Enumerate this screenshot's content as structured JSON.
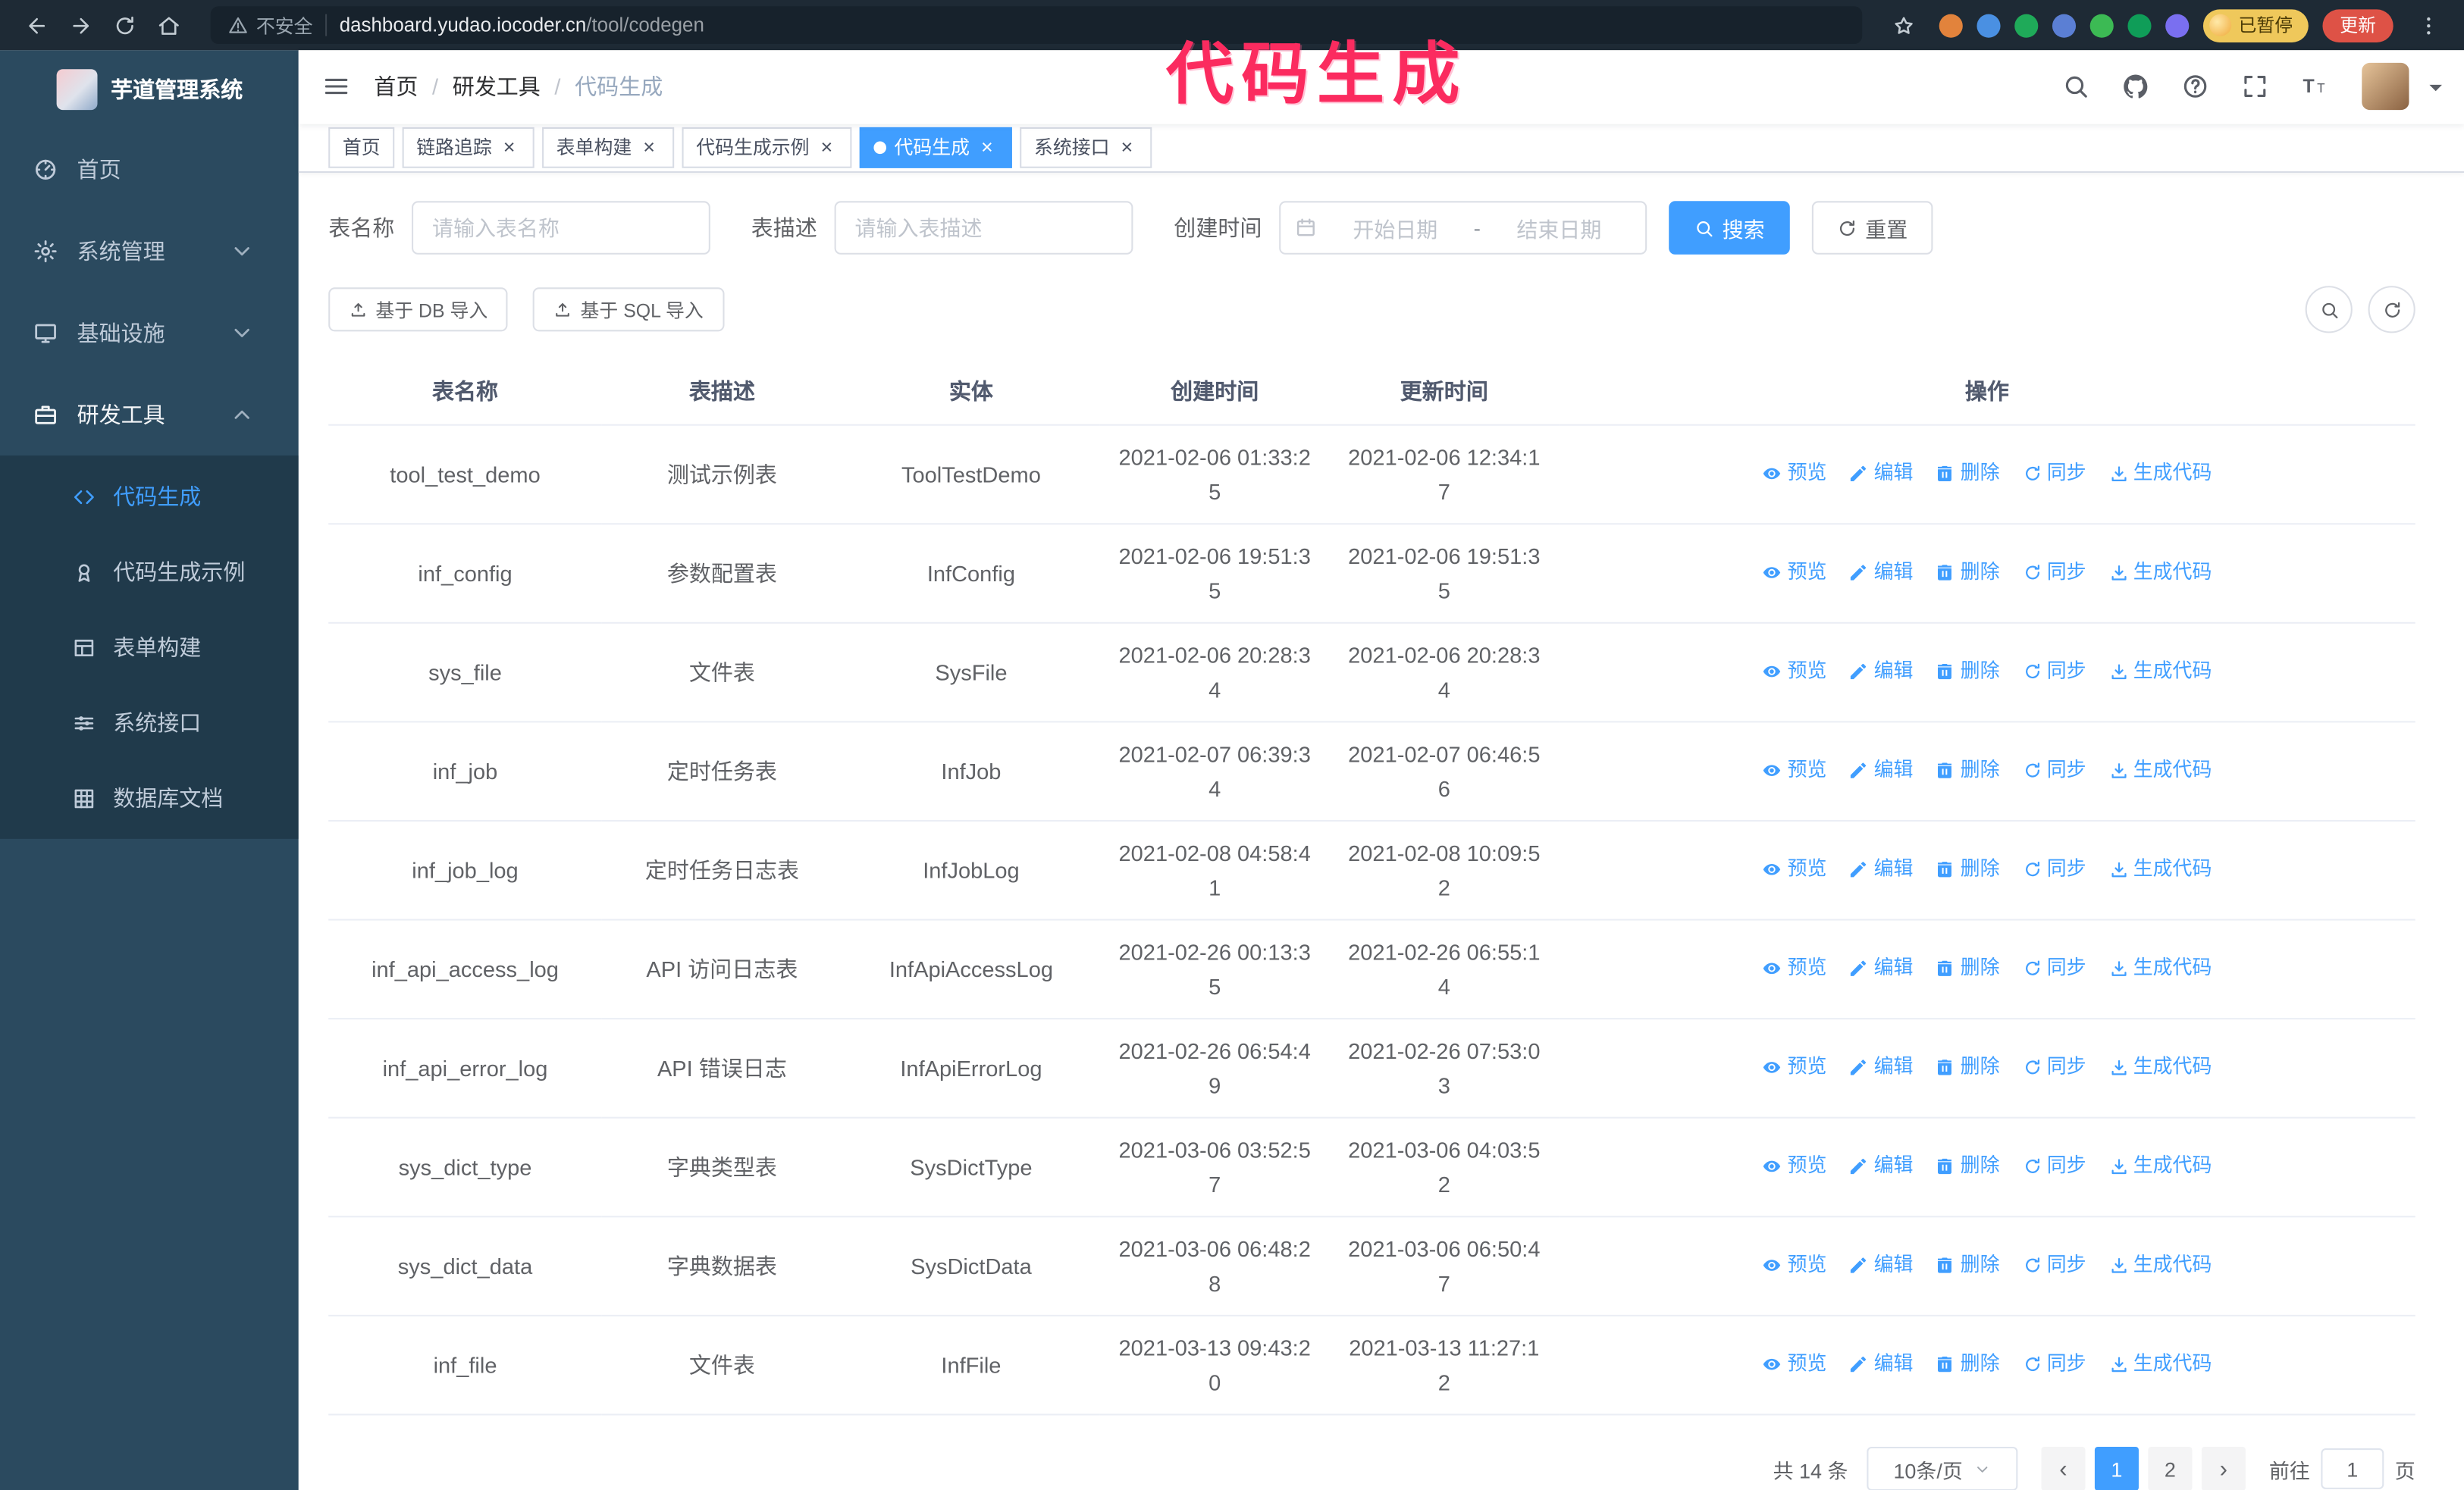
{
  "theme": {
    "accent": "#409eff"
  },
  "browser": {
    "security_label": "不安全",
    "url_host": "dashboard.yudao.iocoder.cn",
    "url_path": "/tool/codegen",
    "profile_chip": "已暂停",
    "update_button": "更新",
    "extension_colors": [
      "#e2833c",
      "#4a90e2",
      "#1faa59",
      "#5b7fd4",
      "#3cba54",
      "#0f9d58",
      "#7a6ff0"
    ]
  },
  "annotation": {
    "text": "代码生成",
    "color": "#fb2b5f"
  },
  "sidebar": {
    "logo_title": "芋道管理系统",
    "items": [
      {
        "key": "home",
        "label": "首页",
        "icon": "dashboard",
        "expandable": false,
        "expanded": false
      },
      {
        "key": "system",
        "label": "系统管理",
        "icon": "gear",
        "expandable": true,
        "expanded": false
      },
      {
        "key": "infra",
        "label": "基础设施",
        "icon": "monitor",
        "expandable": true,
        "expanded": false
      },
      {
        "key": "devtools",
        "label": "研发工具",
        "icon": "toolbox",
        "expandable": true,
        "expanded": true
      }
    ],
    "subitems": [
      {
        "key": "codegen",
        "label": "代码生成",
        "icon": "code",
        "active": true
      },
      {
        "key": "codegen-demo",
        "label": "代码生成示例",
        "icon": "badge",
        "active": false
      },
      {
        "key": "form-builder",
        "label": "表单构建",
        "icon": "form",
        "active": false
      },
      {
        "key": "api",
        "label": "系统接口",
        "icon": "sliders",
        "active": false
      },
      {
        "key": "db-doc",
        "label": "数据库文档",
        "icon": "grid",
        "active": false
      }
    ]
  },
  "header": {
    "breadcrumb": [
      "首页",
      "研发工具",
      "代码生成"
    ],
    "separator": "/"
  },
  "tabs": [
    {
      "key": "home",
      "label": "首页",
      "closable": false,
      "active": false
    },
    {
      "key": "tracer",
      "label": "链路追踪",
      "closable": true,
      "active": false
    },
    {
      "key": "form-builder",
      "label": "表单构建",
      "closable": true,
      "active": false
    },
    {
      "key": "codegen-demo",
      "label": "代码生成示例",
      "closable": true,
      "active": false
    },
    {
      "key": "codegen",
      "label": "代码生成",
      "closable": true,
      "active": true
    },
    {
      "key": "api",
      "label": "系统接口",
      "closable": true,
      "active": false
    }
  ],
  "filters": {
    "table_name_label": "表名称",
    "table_name_placeholder": "请输入表名称",
    "table_desc_label": "表描述",
    "table_desc_placeholder": "请输入表描述",
    "create_time_label": "创建时间",
    "date_start_placeholder": "开始日期",
    "date_separator": "-",
    "date_end_placeholder": "结束日期",
    "search_button": "搜索",
    "reset_button": "重置"
  },
  "toolbar": {
    "import_db": "基于 DB 导入",
    "import_sql": "基于 SQL 导入"
  },
  "table": {
    "columns": [
      "表名称",
      "表描述",
      "实体",
      "创建时间",
      "更新时间",
      "操作"
    ],
    "actions": [
      "预览",
      "编辑",
      "删除",
      "同步",
      "生成代码"
    ],
    "rows": [
      {
        "name": "tool_test_demo",
        "desc": "测试示例表",
        "entity": "ToolTestDemo",
        "created": "2021-02-06 01:33:25",
        "updated": "2021-02-06 12:34:17"
      },
      {
        "name": "inf_config",
        "desc": "参数配置表",
        "entity": "InfConfig",
        "created": "2021-02-06 19:51:35",
        "updated": "2021-02-06 19:51:35"
      },
      {
        "name": "sys_file",
        "desc": "文件表",
        "entity": "SysFile",
        "created": "2021-02-06 20:28:34",
        "updated": "2021-02-06 20:28:34"
      },
      {
        "name": "inf_job",
        "desc": "定时任务表",
        "entity": "InfJob",
        "created": "2021-02-07 06:39:34",
        "updated": "2021-02-07 06:46:56"
      },
      {
        "name": "inf_job_log",
        "desc": "定时任务日志表",
        "entity": "InfJobLog",
        "created": "2021-02-08 04:58:41",
        "updated": "2021-02-08 10:09:52"
      },
      {
        "name": "inf_api_access_log",
        "desc": "API 访问日志表",
        "entity": "InfApiAccessLog",
        "created": "2021-02-26 00:13:35",
        "updated": "2021-02-26 06:55:14"
      },
      {
        "name": "inf_api_error_log",
        "desc": "API 错误日志",
        "entity": "InfApiErrorLog",
        "created": "2021-02-26 06:54:49",
        "updated": "2021-02-26 07:53:03"
      },
      {
        "name": "sys_dict_type",
        "desc": "字典类型表",
        "entity": "SysDictType",
        "created": "2021-03-06 03:52:57",
        "updated": "2021-03-06 04:03:52"
      },
      {
        "name": "sys_dict_data",
        "desc": "字典数据表",
        "entity": "SysDictData",
        "created": "2021-03-06 06:48:28",
        "updated": "2021-03-06 06:50:47"
      },
      {
        "name": "inf_file",
        "desc": "文件表",
        "entity": "InfFile",
        "created": "2021-03-13 09:43:20",
        "updated": "2021-03-13 11:27:12"
      }
    ]
  },
  "pagination": {
    "total": "共 14 条",
    "page_size": "10条/页",
    "pages": [
      "1",
      "2"
    ],
    "current": "1",
    "goto_label": "前往",
    "goto_value": "1",
    "page_label": "页"
  }
}
